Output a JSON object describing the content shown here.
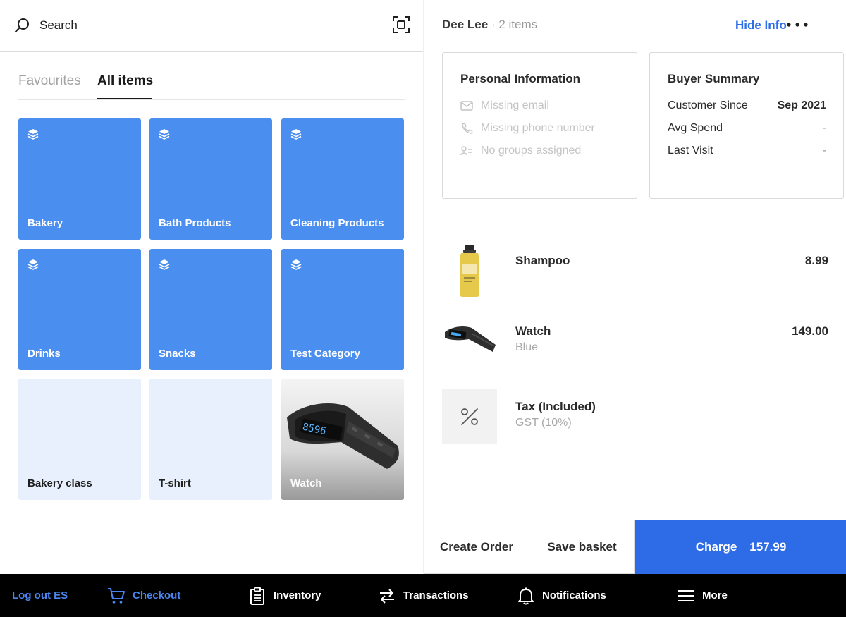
{
  "search": {
    "label": "Search"
  },
  "tabs": [
    {
      "label": "Favourites",
      "active": false
    },
    {
      "label": "All items",
      "active": true
    }
  ],
  "tiles": [
    {
      "label": "Bakery",
      "kind": "category"
    },
    {
      "label": "Bath Products",
      "kind": "category"
    },
    {
      "label": "Cleaning Products",
      "kind": "category"
    },
    {
      "label": "Drinks",
      "kind": "category"
    },
    {
      "label": "Snacks",
      "kind": "category"
    },
    {
      "label": "Test Category",
      "kind": "category"
    },
    {
      "label": "Bakery class",
      "kind": "item"
    },
    {
      "label": "T-shirt",
      "kind": "item"
    },
    {
      "label": "Watch",
      "kind": "item-photo",
      "display": "8596"
    }
  ],
  "customer": {
    "name": "Dee Lee",
    "separator": "·",
    "item_count": "2 items"
  },
  "header_actions": {
    "hide_info": "Hide Info",
    "more": "more-dots-icon"
  },
  "personal_info": {
    "title": "Personal Information",
    "email": "Missing email",
    "phone": "Missing phone number",
    "groups": "No groups assigned"
  },
  "buyer_summary": {
    "title": "Buyer Summary",
    "rows": [
      {
        "label": "Customer Since",
        "value": "Sep 2021"
      },
      {
        "label": "Avg Spend",
        "value": "-"
      },
      {
        "label": "Last Visit",
        "value": "-"
      }
    ]
  },
  "cart": [
    {
      "name": "Shampoo",
      "sub": "",
      "price": "8.99",
      "icon": "shampoo-bottle"
    },
    {
      "name": "Watch",
      "sub": "Blue",
      "price": "149.00",
      "icon": "watch"
    },
    {
      "name": "Tax (Included)",
      "sub": "GST (10%)",
      "price": "",
      "icon": "percent-icon"
    }
  ],
  "actions": {
    "create_order": "Create Order",
    "save_basket": "Save basket",
    "charge": "Charge",
    "charge_amount": "157.99"
  },
  "nav": {
    "logout": "Log out ES",
    "items": [
      {
        "label": "Checkout",
        "icon": "cart-icon",
        "active": true
      },
      {
        "label": "Inventory",
        "icon": "clipboard-icon",
        "active": false
      },
      {
        "label": "Transactions",
        "icon": "swap-icon",
        "active": false
      },
      {
        "label": "Notifications",
        "icon": "bell-icon",
        "active": false
      },
      {
        "label": "More",
        "icon": "menu-icon",
        "active": false
      }
    ]
  },
  "colors": {
    "accent": "#2e6be6",
    "tile_blue": "#4a8ef0",
    "tile_light": "#e8f0fd",
    "nav_bg": "#000000"
  }
}
